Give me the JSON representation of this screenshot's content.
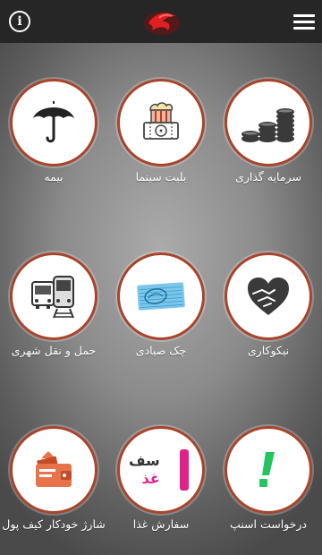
{
  "header": {
    "info_icon": "info-icon",
    "info_glyph": "i",
    "logo_icon": "brand-logo-icon",
    "menu_icon": "hamburger-menu-icon"
  },
  "tiles": [
    {
      "id": "insurance",
      "label": "بیمه",
      "icon": "umbrella-icon"
    },
    {
      "id": "cinema",
      "label": "بلیت سینما",
      "icon": "cinema-ticket-icon"
    },
    {
      "id": "investment",
      "label": "سرمایه گذاری",
      "icon": "coin-stacks-icon"
    },
    {
      "id": "transport",
      "label": "حمل و نقل شهری",
      "icon": "bus-train-icon"
    },
    {
      "id": "cheque",
      "label": "چک صیادی",
      "icon": "cheque-icon"
    },
    {
      "id": "charity",
      "label": "نیکوکاری",
      "icon": "heart-hands-icon"
    },
    {
      "id": "wallet",
      "label": "شارژ خودکار کیف پول",
      "icon": "wallet-icon"
    },
    {
      "id": "food",
      "label": "سفارش غذا",
      "icon": "snappfood-icon"
    },
    {
      "id": "snapp",
      "label": "درخواست اسنپ",
      "icon": "snapp-icon"
    }
  ],
  "food_logo_text": "سف\nغذ",
  "colors": {
    "accent": "#a8442c",
    "topbar": "#262626",
    "snapp_green": "#22c55e",
    "food_pink": "#e0218a"
  }
}
